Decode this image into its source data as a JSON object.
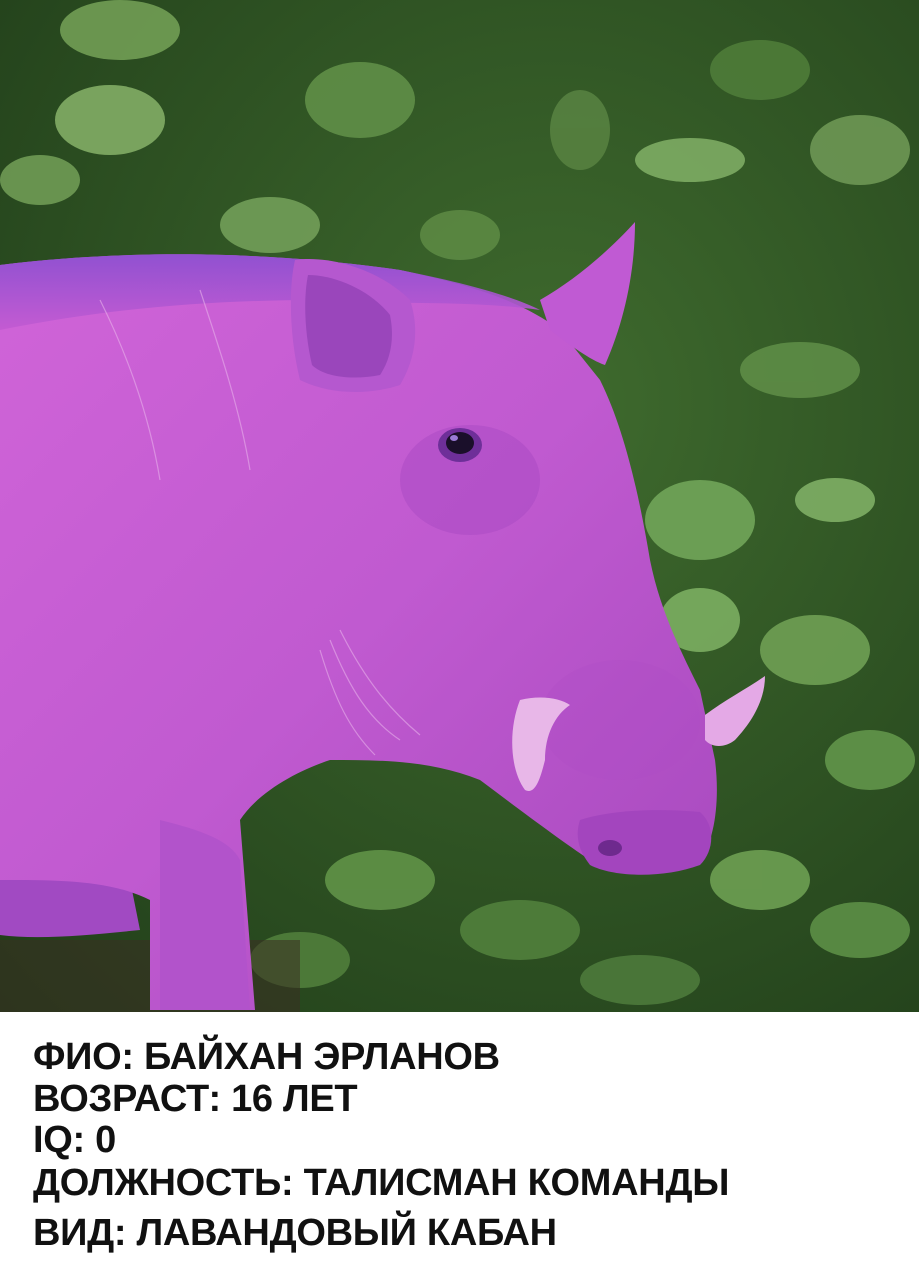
{
  "photo": {
    "subject": "warthog",
    "tint": "#c45bd6",
    "background": "green foliage"
  },
  "caption": {
    "lines": [
      "ФИО: БАЙХАН ЭРЛАНОВ",
      "ВОЗРАСТ: 16 ЛЕТ",
      "IQ: 0",
      "ДОЛЖНОСТЬ: ТАЛИСМАН КОМАНДЫ",
      "ВИД: ЛАВАНДОВЫЙ КАБАН"
    ]
  }
}
